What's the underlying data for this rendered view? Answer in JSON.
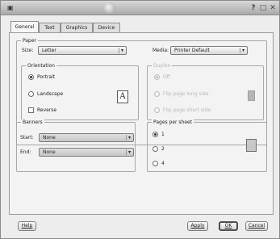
{
  "window": {
    "title_icon": "printer-app-icon",
    "help_glyph": "?",
    "maximize_glyph": "□",
    "close_glyph": "✕"
  },
  "tabs": [
    {
      "label": "General",
      "active": true
    },
    {
      "label": "Text",
      "active": false
    },
    {
      "label": "Graphics",
      "active": false
    },
    {
      "label": "Device",
      "active": false
    }
  ],
  "paper": {
    "legend": "Paper",
    "size_label": "Size:",
    "size_value": "Letter",
    "media_label": "Media:",
    "media_value": "Printer Default",
    "orientation": {
      "legend": "Orientation",
      "options": [
        "Portrait",
        "Landscape",
        "Reverse"
      ],
      "selected": "Portrait",
      "preview_letter": "A"
    },
    "duplex": {
      "legend": "Duplex",
      "options": [
        "Off",
        "Flip page long side",
        "Flip page short side"
      ],
      "selected": "Off",
      "enabled": false
    }
  },
  "banners": {
    "legend": "Banners",
    "start_label": "Start:",
    "start_value": "None",
    "end_label": "End:",
    "end_value": "None"
  },
  "pages_per_sheet": {
    "legend": "Pages per sheet",
    "options": [
      "1",
      "2",
      "4"
    ],
    "selected": "1"
  },
  "buttons": {
    "help": "Help",
    "apply": "Apply",
    "ok": "OK",
    "cancel": "Cancel"
  },
  "colors": {
    "window_bg": "#ededed",
    "panel_bg": "#f3f3f3",
    "disabled_text": "#b8b8b8"
  }
}
